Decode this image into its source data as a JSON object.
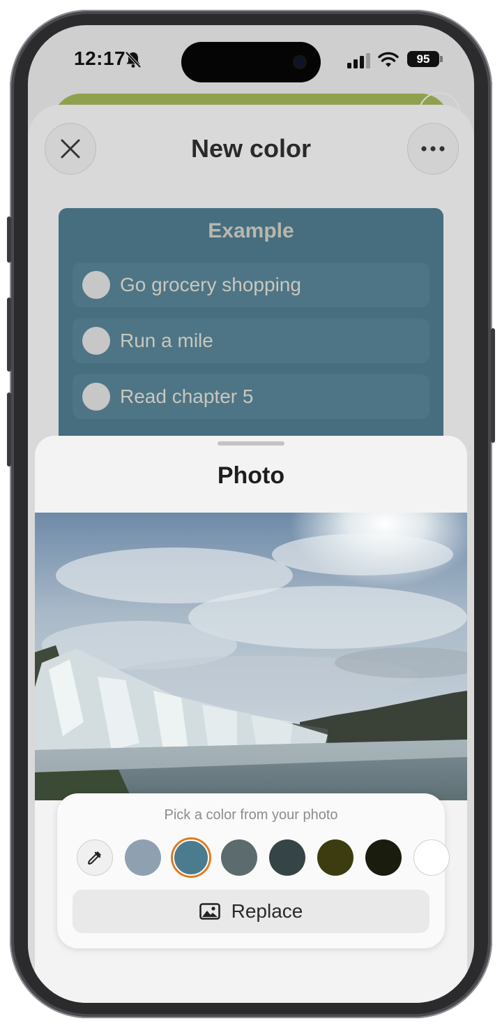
{
  "status_bar": {
    "time": "12:17",
    "battery": "95",
    "icons": [
      "bell-slash-icon",
      "signal-icon",
      "wifi-icon",
      "battery-icon"
    ]
  },
  "new_color_sheet": {
    "title": "New color",
    "close_icon": "close-icon",
    "more_icon": "more-icon",
    "example": {
      "title": "Example",
      "background": "#466e7f",
      "tasks": [
        {
          "label": "Go grocery shopping"
        },
        {
          "label": "Run a mile"
        },
        {
          "label": "Read chapter 5"
        }
      ]
    }
  },
  "photo_sheet": {
    "title": "Photo",
    "photo_subject": "waterfall under cloudy sky",
    "picker": {
      "hint": "Pick a color from your photo",
      "eyedropper_icon": "eyedropper-icon",
      "swatches": [
        "#8fa0b1",
        "#4b7b8f",
        "#5c6b6e",
        "#354446",
        "#3c3c10",
        "#1a1c0e",
        "#ffffff"
      ],
      "selected_swatch_index": 1,
      "replace_icon": "photo-icon",
      "replace_label": "Replace"
    }
  }
}
